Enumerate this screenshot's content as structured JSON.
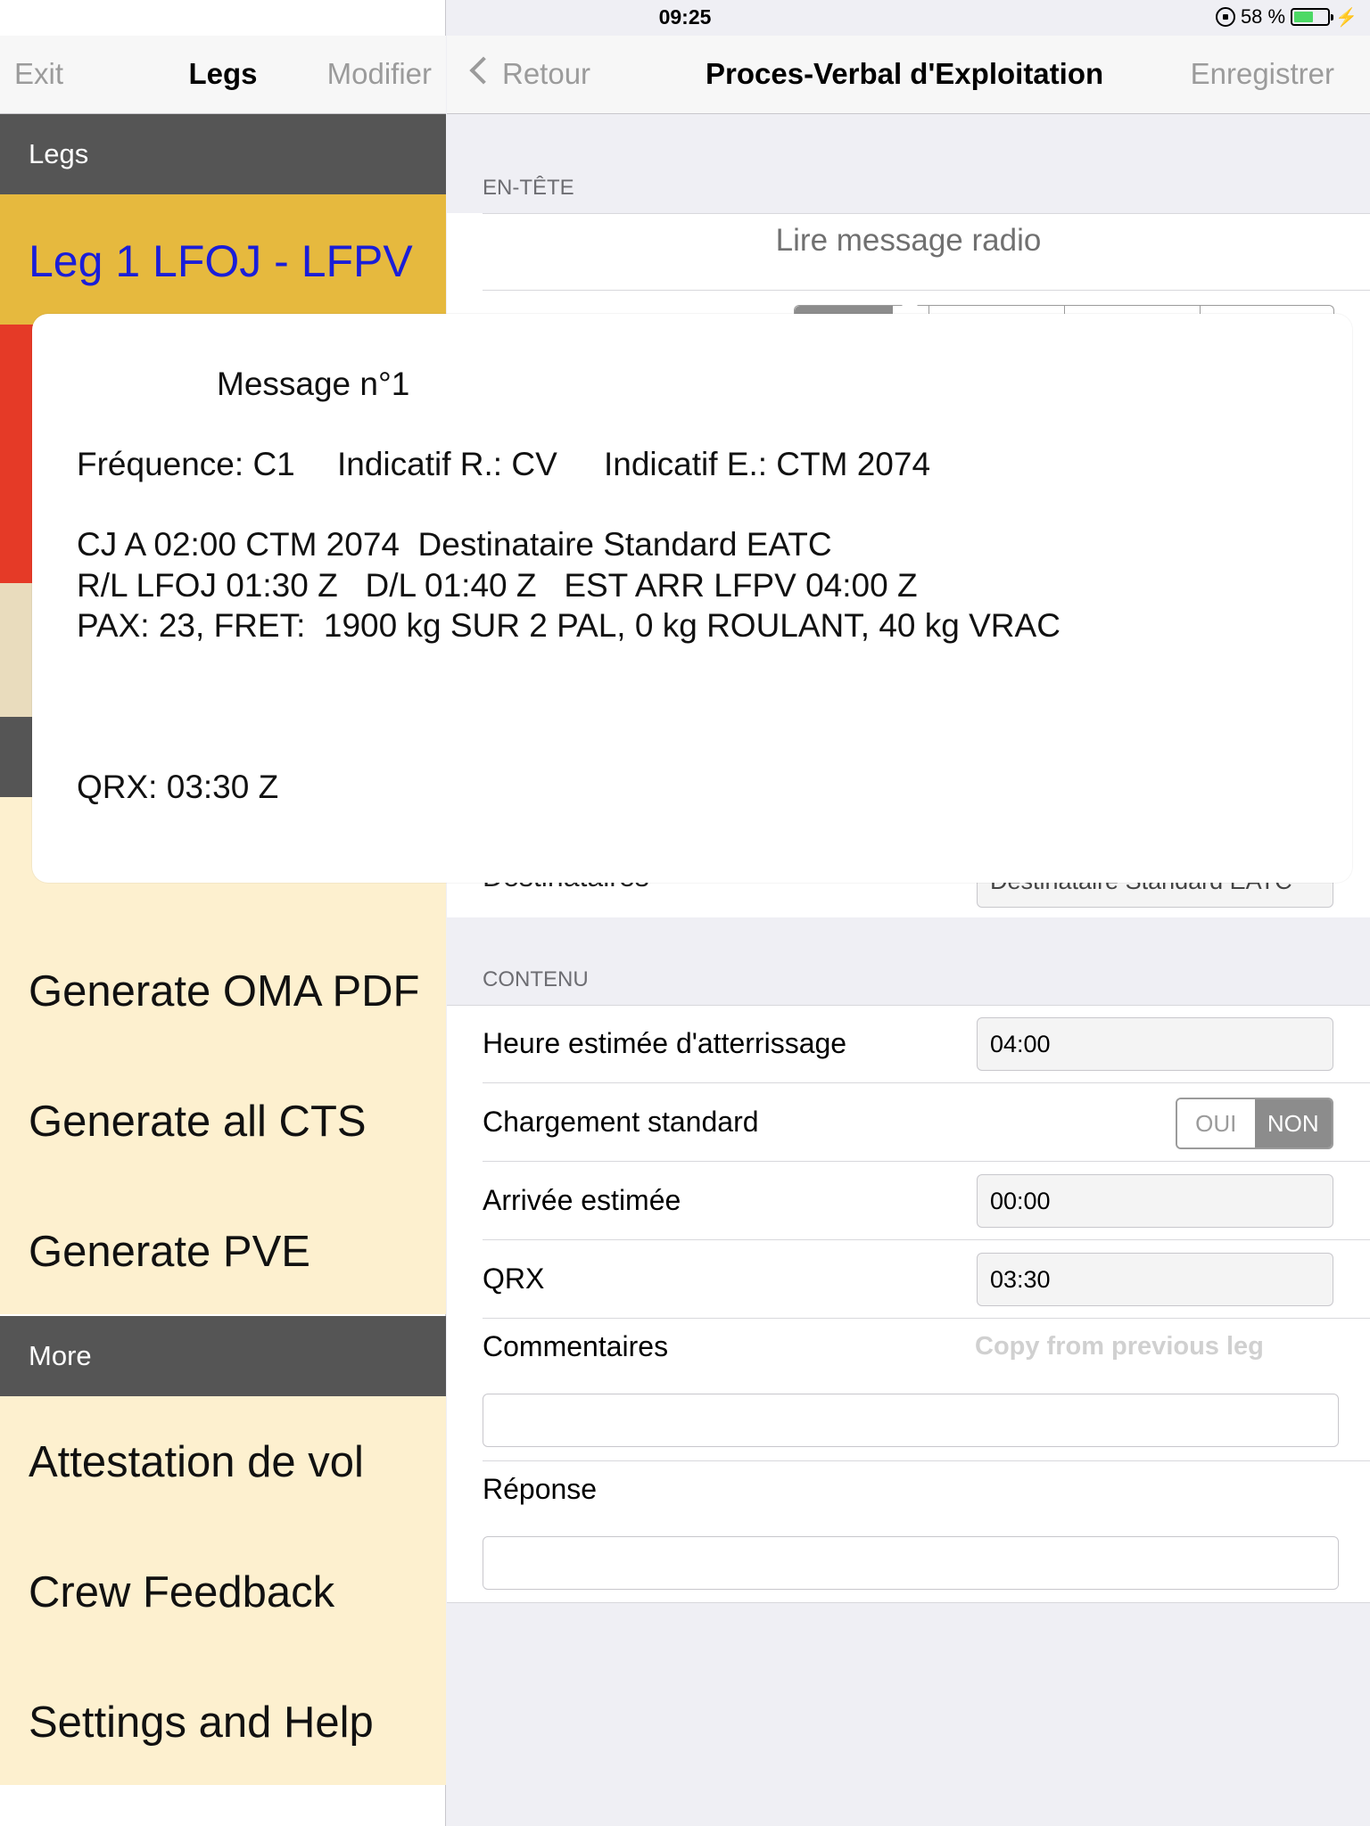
{
  "status_bar": {
    "device": "iPad",
    "time": "09:25",
    "battery_text": "58 %",
    "battery_level": 0.58
  },
  "left_nav": {
    "exit": "Exit",
    "title": "Legs",
    "modifier": "Modifier"
  },
  "left_sections": {
    "legs_header": "Legs",
    "leg_label": "Leg 1   LFOJ - LFPV",
    "more_header": "More"
  },
  "left_menu": {
    "generate_oma_pdf": "Generate OMA PDF",
    "generate_all_cts": "Generate all CTS",
    "generate_pve": "Generate PVE",
    "attestation": "Attestation de vol",
    "crew_feedback": "Crew Feedback",
    "settings_help": "Settings and Help"
  },
  "right_nav": {
    "back": "Retour",
    "title": "Proces-Verbal d'Exploitation",
    "save": "Enregistrer"
  },
  "header_section": {
    "label": "EN-TÊTE",
    "read_radio": "Lire message radio",
    "destinataires_label": "Destinataires",
    "destinataires_value": "Destinataire Standard EATC"
  },
  "content_section": {
    "label": "CONTENU",
    "eta_label": "Heure estimée d'atterrissage",
    "eta_value": "04:00",
    "standard_loading_label": "Chargement standard",
    "oui": "OUI",
    "non": "NON",
    "arrival_label": "Arrivée estimée",
    "arrival_value": "00:00",
    "qrx_label": "QRX",
    "qrx_value": "03:30",
    "comments_label": "Commentaires",
    "copy_previous": "Copy from previous leg",
    "response_label": "Réponse"
  },
  "popover": {
    "title": "Message n°1",
    "frequency": "Fréquence: C1",
    "indicatif_r": "Indicatif R.: CV",
    "indicatif_e": "Indicatif E.: CTM 2074",
    "line1": "CJ A 02:00 CTM 2074  Destinataire Standard EATC",
    "line2": "R/L LFOJ 01:30 Z   D/L 01:40 Z   EST ARR LFPV 04:00 Z",
    "line3": "PAX: 23, FRET:  1900 kg SUR 2 PAL, 0 kg ROULANT, 40 kg VRAC",
    "qrx": "QRX: 03:30 Z"
  },
  "colors": {
    "leg_bg": "#e6b93e",
    "leg_text": "#1a1ed8",
    "red": "#e53a27",
    "cream": "#fdf0cf",
    "section_dark": "#555555"
  }
}
